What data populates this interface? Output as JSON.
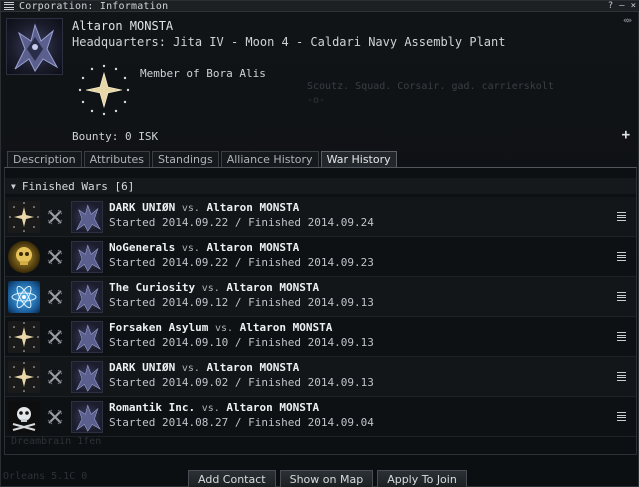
{
  "window": {
    "title": "Corporation: Information",
    "controls": [
      "?",
      "–",
      "×"
    ],
    "collapse_arrows": "«»"
  },
  "corporation": {
    "name": "Altaron MONSTA",
    "headquarters": "Headquarters: Jita IV - Moon 4 - Caldari Navy Assembly Plant",
    "member_of": "Member of Bora Alis",
    "bounty": "Bounty: 0 ISK",
    "faded_line1": "Scoutz. Squad. Corsair. gad. carrierskolt",
    "faded_line2": "-o-"
  },
  "tabs": [
    {
      "label": "Description",
      "active": false
    },
    {
      "label": "Attributes",
      "active": false
    },
    {
      "label": "Standings",
      "active": false
    },
    {
      "label": "Alliance History",
      "active": false
    },
    {
      "label": "War History",
      "active": true
    }
  ],
  "section": {
    "label": "Finished Wars",
    "count": "[6]"
  },
  "wars": [
    {
      "aggressor": "DARK UNIØN",
      "vs": "vs.",
      "defender": "Altaron MONSTA",
      "dates": "Started 2014.09.22 / Finished 2014.09.24",
      "aggressor_icon": "star-logo-icon"
    },
    {
      "aggressor": "NoGenerals",
      "vs": "vs.",
      "defender": "Altaron MONSTA",
      "dates": "Started 2014.09.22 / Finished 2014.09.23",
      "aggressor_icon": "gold-skull-logo-icon"
    },
    {
      "aggressor": "The Curiosity",
      "vs": "vs.",
      "defender": "Altaron MONSTA",
      "dates": "Started 2014.09.12 / Finished 2014.09.13",
      "aggressor_icon": "atom-logo-icon"
    },
    {
      "aggressor": "Forsaken Asylum",
      "vs": "vs.",
      "defender": "Altaron MONSTA",
      "dates": "Started 2014.09.10 / Finished 2014.09.13",
      "aggressor_icon": "star-logo-icon"
    },
    {
      "aggressor": "DARK UNIØN",
      "vs": "vs.",
      "defender": "Altaron MONSTA",
      "dates": "Started 2014.09.02 / Finished 2014.09.13",
      "aggressor_icon": "star-logo-icon"
    },
    {
      "aggressor": "Romantik Inc.",
      "vs": "vs.",
      "defender": "Altaron MONSTA",
      "dates": "Started 2014.08.27 / Finished 2014.09.04",
      "aggressor_icon": "skull-crossbones-logo-icon"
    }
  ],
  "ghost_text": {
    "line1": "Dreambrain 1fen",
    "line2": "Orleans 5.1C 0"
  },
  "footer": {
    "add_contact": "Add Contact",
    "show_on_map": "Show on Map",
    "apply_to_join": "Apply To Join"
  },
  "colors": {
    "background": "#0b0d0f",
    "text": "#cfd3d6",
    "accent_star": "#e8d7a8",
    "atom_blue": "#2b8fd6"
  }
}
